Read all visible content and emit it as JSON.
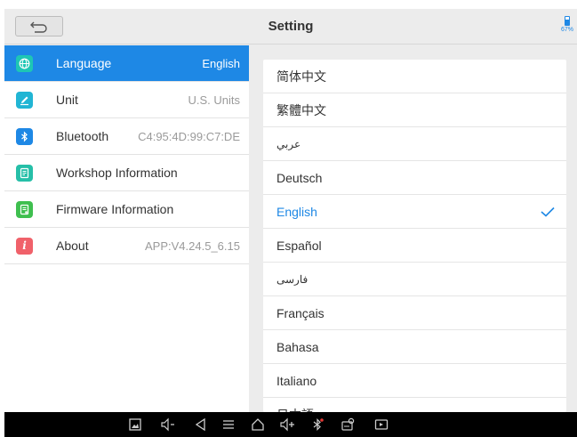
{
  "header": {
    "title": "Setting",
    "battery": {
      "level_percent": 67,
      "text": "67%"
    }
  },
  "sidebar": {
    "items": [
      {
        "label": "Language",
        "value": "English",
        "icon": "globe-icon",
        "color": "#1ec6b4",
        "active": true
      },
      {
        "label": "Unit",
        "value": "U.S. Units",
        "icon": "pencil-icon",
        "color": "#21b5d4",
        "active": false
      },
      {
        "label": "Bluetooth",
        "value": "C4:95:4D:99:C7:DE",
        "icon": "bluetooth-icon",
        "color": "#1e88e5",
        "active": false
      },
      {
        "label": "Workshop Information",
        "value": "",
        "icon": "document-icon",
        "color": "#26bfa8",
        "active": false
      },
      {
        "label": "Firmware Information",
        "value": "",
        "icon": "firmware-icon",
        "color": "#3fbf4f",
        "active": false
      },
      {
        "label": "About",
        "value": "APP:V4.24.5_6.15",
        "icon": "info-icon",
        "color": "#f0616a",
        "active": false
      }
    ]
  },
  "languages": {
    "items": [
      {
        "label": "简体中文",
        "selected": false
      },
      {
        "label": "繁體中文",
        "selected": false
      },
      {
        "label": "عربي",
        "selected": false
      },
      {
        "label": "Deutsch",
        "selected": false
      },
      {
        "label": "English",
        "selected": true
      },
      {
        "label": "Español",
        "selected": false
      },
      {
        "label": "فارسی",
        "selected": false
      },
      {
        "label": "Français",
        "selected": false
      },
      {
        "label": "Bahasa",
        "selected": false
      },
      {
        "label": "Italiano",
        "selected": false
      },
      {
        "label": "日本語",
        "selected": false
      }
    ]
  },
  "navbar": {
    "icons": [
      "screenshot-icon",
      "volume-down-icon",
      "back-icon",
      "menu-icon",
      "home-icon",
      "volume-up-icon",
      "bluetooth-icon",
      "vci-icon",
      "screen-record-icon"
    ]
  },
  "colors": {
    "accent": "#1e88e5",
    "background": "#ececec",
    "navbar": "#000000"
  }
}
